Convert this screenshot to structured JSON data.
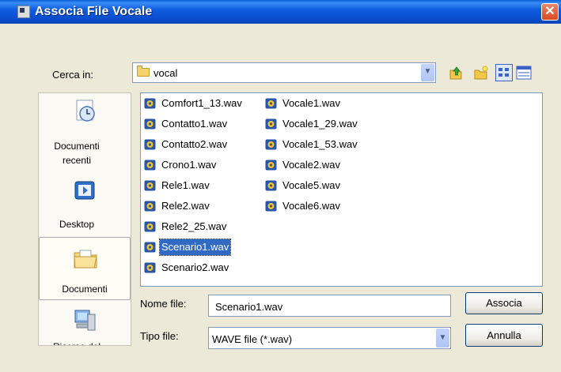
{
  "window": {
    "title": "Associa File Vocale",
    "close_glyph": "✕"
  },
  "look_in": {
    "label": "Cerca in:",
    "value": "vocal"
  },
  "places": [
    {
      "label": "Documenti recenti",
      "icon": "recent-documents-icon"
    },
    {
      "label": "Desktop",
      "icon": "desktop-icon"
    },
    {
      "label": "Documenti",
      "icon": "documents-folder-icon",
      "selected": true
    },
    {
      "label": "Risorse del",
      "icon": "my-computer-icon"
    }
  ],
  "files_col1": [
    "Comfort1_13.wav",
    "Contatto1.wav",
    "Contatto2.wav",
    "Crono1.wav",
    "Rele1.wav",
    "Rele2.wav",
    "Rele2_25.wav",
    "Scenario1.wav",
    "Scenario2.wav"
  ],
  "files_col2": [
    "Vocale1.wav",
    "Vocale1_29.wav",
    "Vocale1_53.wav",
    "Vocale2.wav",
    "Vocale5.wav",
    "Vocale6.wav"
  ],
  "selected_file": "Scenario1.wav",
  "filename": {
    "label": "Nome file:",
    "value": "Scenario1.wav"
  },
  "filetype": {
    "label": "Tipo file:",
    "value": "WAVE file (*.wav)"
  },
  "buttons": {
    "ok": "Associa",
    "cancel": "Annulla"
  },
  "colors": {
    "titlebar": "#0a4fd0",
    "selection": "#316ac5",
    "dialog_bg": "#ece9d8"
  }
}
